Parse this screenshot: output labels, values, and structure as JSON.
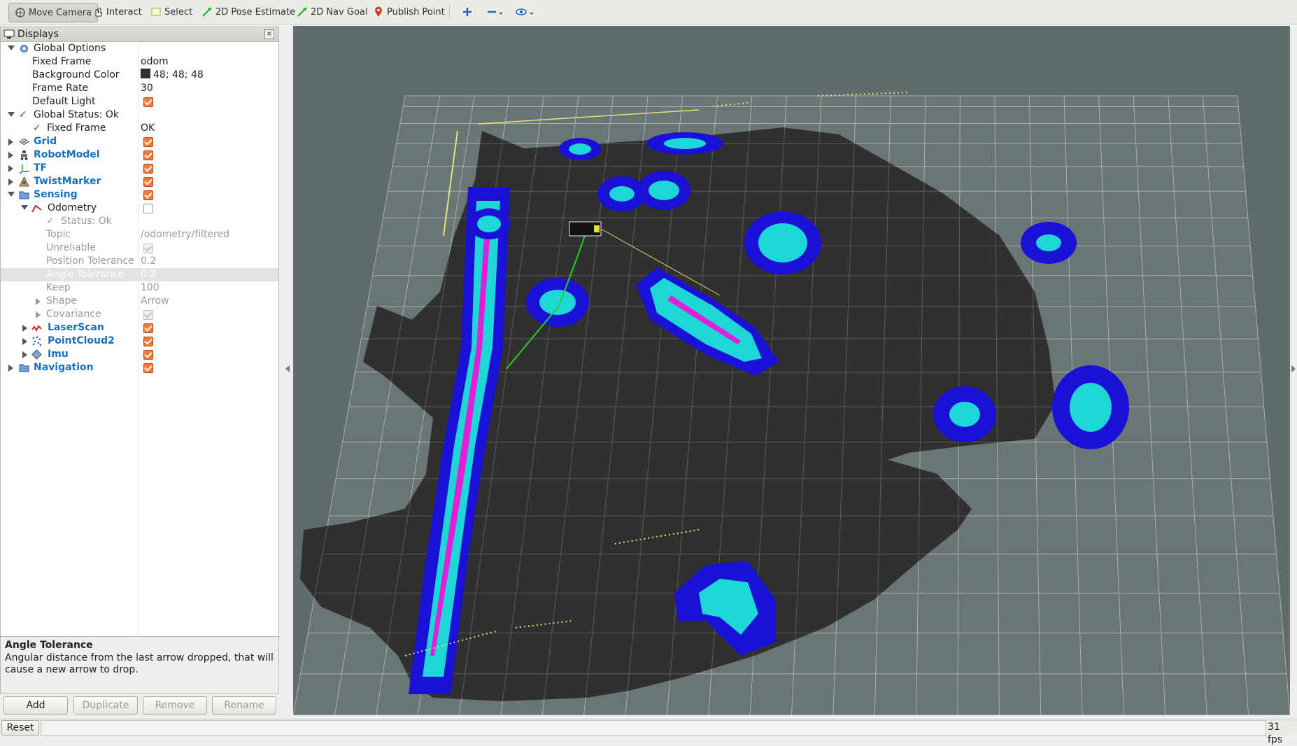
{
  "toolbar": {
    "move_camera": "Move Camera",
    "interact": "Interact",
    "select": "Select",
    "pose_estimate": "2D Pose Estimate",
    "nav_goal": "2D Nav Goal",
    "publish_point": "Publish Point",
    "icons": [
      "move-camera-icon",
      "interact-icon",
      "select-icon",
      "pose-estimate-icon",
      "nav-goal-icon",
      "publish-point-icon",
      "plus-icon",
      "minus-icon",
      "eye-icon"
    ]
  },
  "displays": {
    "title": "Displays",
    "rows": [
      {
        "label": "Global Options",
        "value": ""
      },
      {
        "label": "Fixed Frame",
        "value": "odom"
      },
      {
        "label": "Background Color",
        "value": "48; 48; 48"
      },
      {
        "label": "Frame Rate",
        "value": "30"
      },
      {
        "label": "Default Light",
        "value": ""
      },
      {
        "label": "Global Status: Ok",
        "value": ""
      },
      {
        "label": "Fixed Frame",
        "value": "OK"
      },
      {
        "label": "Grid",
        "value": ""
      },
      {
        "label": "RobotModel",
        "value": ""
      },
      {
        "label": "TF",
        "value": ""
      },
      {
        "label": "TwistMarker",
        "value": ""
      },
      {
        "label": "Sensing",
        "value": ""
      },
      {
        "label": "Odometry",
        "value": ""
      },
      {
        "label": "Status: Ok",
        "value": ""
      },
      {
        "label": "Topic",
        "value": "/odometry/filtered"
      },
      {
        "label": "Unreliable",
        "value": ""
      },
      {
        "label": "Position Tolerance",
        "value": "0.2"
      },
      {
        "label": "Angle Tolerance",
        "value": "0.2"
      },
      {
        "label": "Keep",
        "value": "100"
      },
      {
        "label": "Shape",
        "value": "Arrow"
      },
      {
        "label": "Covariance",
        "value": ""
      },
      {
        "label": "LaserScan",
        "value": ""
      },
      {
        "label": "PointCloud2",
        "value": ""
      },
      {
        "label": "Imu",
        "value": ""
      },
      {
        "label": "Navigation",
        "value": ""
      }
    ],
    "background_color_hex": "#303030"
  },
  "description": {
    "title": "Angle Tolerance",
    "text": "Angular distance from the last arrow dropped, that will cause a new arrow to drop."
  },
  "buttons": {
    "add": "Add",
    "duplicate": "Duplicate",
    "remove": "Remove",
    "rename": "Rename"
  },
  "status": {
    "reset": "Reset",
    "fps": "31 fps"
  },
  "colors": {
    "viewport_bg": "#5f6b6c",
    "map_free": "#303030",
    "inflation": "#1a10d8",
    "obstacle": "#1fd6d6",
    "lethal": "#e21fd8",
    "grid": "#9aa4a6",
    "path": "#1fd31f",
    "checkbox": "#f07a3a"
  }
}
